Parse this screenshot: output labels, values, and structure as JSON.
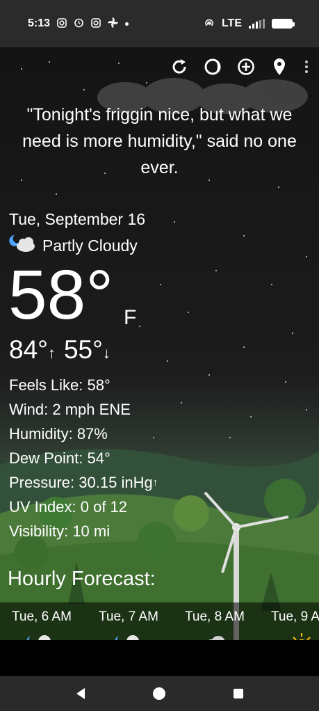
{
  "status_bar": {
    "time": "5:13",
    "network": "LTE",
    "left_icons": [
      "instagram-icon",
      "alarm-icon",
      "instagram-icon",
      "pinwheel-icon",
      "dot-icon"
    ],
    "right_icons": [
      "hotspot-icon",
      "signal-icon",
      "battery-icon"
    ]
  },
  "toolbar": {
    "buttons": [
      "refresh-icon",
      "moon-phase-icon",
      "add-location-icon",
      "location-pin-icon",
      "more-options-icon"
    ]
  },
  "quote": "\"Tonight's friggin nice, but what we need is more humidity,\" said no one ever.",
  "current": {
    "date": "Tue, September 16",
    "condition": "Partly Cloudy",
    "temperature": "58°",
    "unit": "F",
    "high": "84°",
    "high_arrow": "↑",
    "low": "55°",
    "low_arrow": "↓"
  },
  "details": [
    {
      "label": "Feels Like:",
      "value": "58°"
    },
    {
      "label": "Wind:",
      "value": "2 mph ENE"
    },
    {
      "label": "Humidity:",
      "value": "87%"
    },
    {
      "label": "Dew Point:",
      "value": "54°"
    },
    {
      "label": "Pressure:",
      "value": "30.15 inHg",
      "trend": "↑"
    },
    {
      "label": "UV Index:",
      "value": "0 of 12"
    },
    {
      "label": "Visibility:",
      "value": "10 mi"
    }
  ],
  "hourly": {
    "title": "Hourly Forecast:",
    "items": [
      {
        "time": "Tue, 6 AM",
        "icon": "partly-cloudy-night-icon"
      },
      {
        "time": "Tue, 7 AM",
        "icon": "partly-cloudy-night-icon"
      },
      {
        "time": "Tue, 8 AM",
        "icon": "cloudy-icon"
      },
      {
        "time": "Tue, 9 A",
        "icon": "sun-icon"
      }
    ]
  },
  "nav": {
    "buttons": [
      "back-button",
      "home-button",
      "recents-button"
    ]
  },
  "colors": {
    "sky": "#141414",
    "grass": "#3d6a3a",
    "status_bar": "#2b2b2b",
    "nav_bar": "#2a2a2a"
  }
}
